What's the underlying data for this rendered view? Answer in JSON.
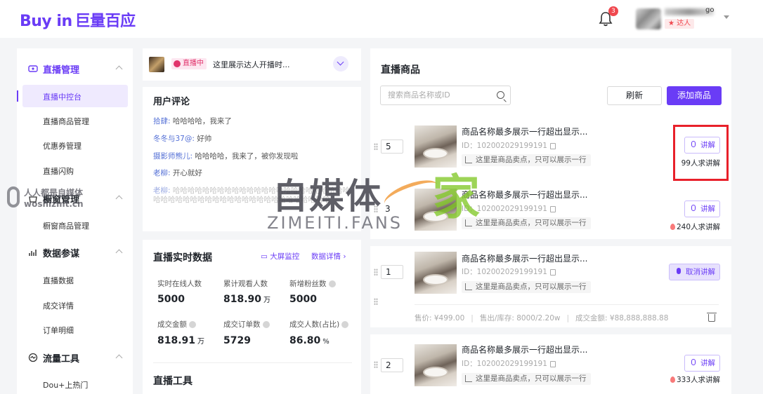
{
  "colors": {
    "brand": "#6a3cf6",
    "alert": "#f0484f",
    "highlight": "#e8202a"
  },
  "header": {
    "logo_en": "Buy in",
    "logo_cn": "巨量百应",
    "notification_count": "3",
    "user_name_tail": "go",
    "user_badge": "达人"
  },
  "sidebar": {
    "groups": [
      {
        "label": "直播管理",
        "icon": "video-icon",
        "items": [
          "直播中控台",
          "直播商品管理",
          "优惠券管理",
          "直播闪购"
        ]
      },
      {
        "label": "橱窗管理",
        "icon": "shop-icon",
        "items": [
          "橱窗商品管理"
        ]
      },
      {
        "label": "数据参谋",
        "icon": "chart-icon",
        "items": [
          "直播数据",
          "成交详情",
          "订单明细"
        ]
      },
      {
        "label": "流量工具",
        "icon": "flow-icon",
        "items": [
          "Dou+上热门"
        ]
      }
    ],
    "active_item": "直播中控台"
  },
  "live_status": {
    "tag": "直播中",
    "text": "这里展示达人开播时..."
  },
  "comments": {
    "title": "用户评论",
    "list": [
      {
        "name": "拾肆:",
        "text": " 哈哈哈哈，我来了"
      },
      {
        "name": "冬冬与37@:",
        "text": " 好帅"
      },
      {
        "name": "摄影师熊儿:",
        "text": " 哈哈哈哈，我来了，被你发现啦"
      },
      {
        "name": "老柳:",
        "text": " 开心就好"
      },
      {
        "name": "老柳:",
        "text": " 哈哈哈哈哈哈哈哈哈哈哈哈哈哈哈哈哈哈哈哈哈哈哈哈哈哈哈哈哈哈哈哈哈哈哈哈哈哈哈哈哈哈哈哈哈哈哈哈"
      }
    ]
  },
  "realtime": {
    "title": "直播实时数据",
    "screen_monitor": "大屏监控",
    "data_detail": "数据详情",
    "stats": [
      {
        "label": "实时在线人数",
        "value": "5000",
        "unit": ""
      },
      {
        "label": "累计观看人数",
        "value": "818.90",
        "unit": "万"
      },
      {
        "label": "新增粉丝数",
        "value": "5000",
        "unit": ""
      },
      {
        "label": "成交金额",
        "value": "818.91",
        "unit": "万"
      },
      {
        "label": "成交订单数",
        "value": "5729",
        "unit": ""
      },
      {
        "label": "成交人数(占比)",
        "value": "86.80",
        "unit": "%"
      }
    ],
    "tools_title": "直播工具"
  },
  "products": {
    "title": "直播商品",
    "search_placeholder": "搜索商品名称或ID",
    "refresh": "刷新",
    "add": "添加商品",
    "items": [
      {
        "rank": "5",
        "title": "商品名称最多展示一行超出显示...",
        "id": "ID：102002029199191",
        "sell": "这里是商品卖点，只可以展示一行",
        "action": "讲解",
        "requests": "99人求讲解"
      },
      {
        "rank": "3",
        "title": "商品名称最多展示一行超出显示...",
        "id": "ID：102002029199191",
        "sell": "这里是商品卖点，只可以展示一行",
        "action": "讲解",
        "requests": "240人求讲解"
      },
      {
        "rank": "1",
        "title": "商品名称最多展示一行超出显示...",
        "id": "ID：102002029199191",
        "sell": "这里是商品卖点，只可以展示一行",
        "action": "取消讲解",
        "requests": "",
        "price": "售价: ¥499.00",
        "stock": "售出/库存: 8000/2.20w",
        "deal": "成交金额: ¥88,888,888.88"
      },
      {
        "rank": "2",
        "title": "商品名称最多展示一行超出显示...",
        "id": "ID：102002029199191",
        "sell": "这里是商品卖点，只可以展示一行",
        "action": "讲解",
        "requests": "333人求讲解"
      }
    ]
  },
  "watermark": {
    "big": "自媒体",
    "jia": "家",
    "sub": "ZIMEITI.FANS",
    "small1": "人人都是自媒体",
    "small2": "woshizmt.cn"
  }
}
